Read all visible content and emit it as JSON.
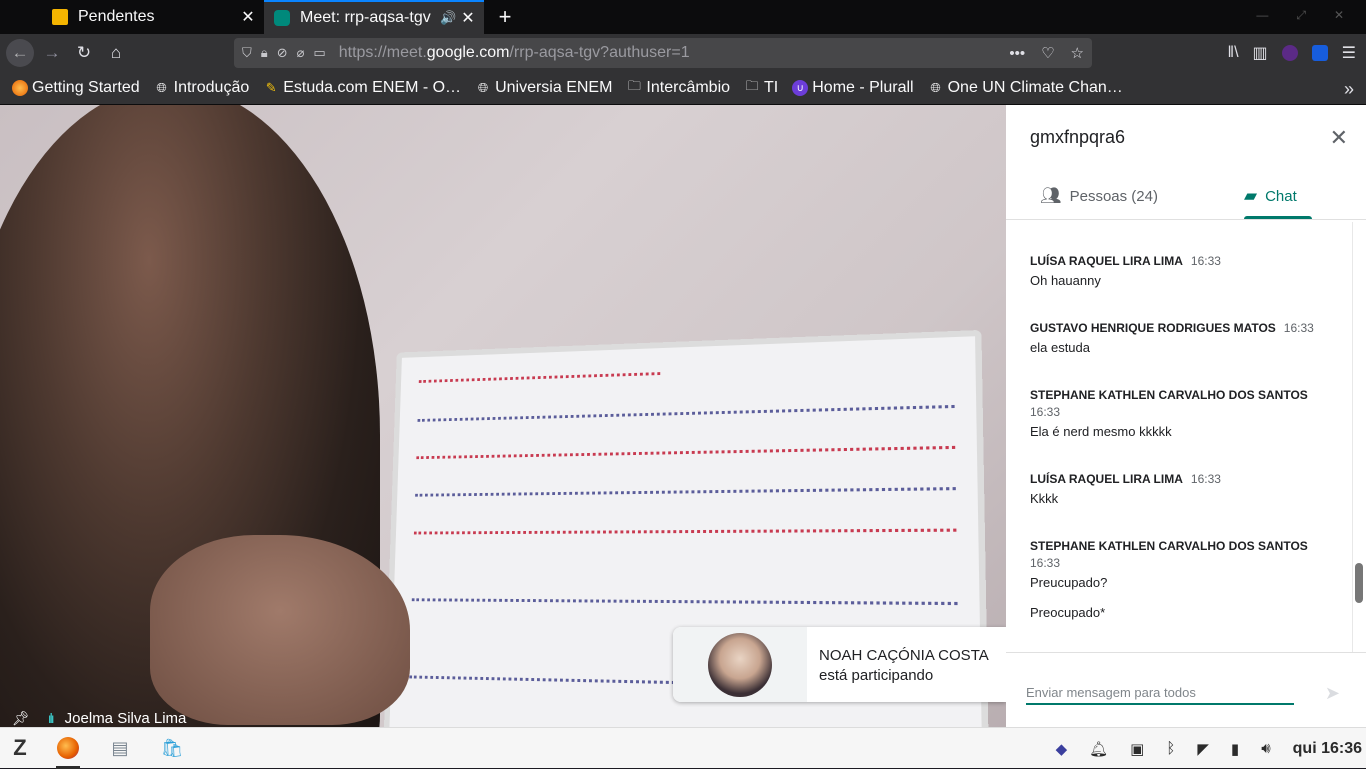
{
  "browser": {
    "tabs": [
      {
        "title": "Pendentes",
        "active": false
      },
      {
        "title": "Meet: rrp-aqsa-tgv",
        "active": true
      }
    ],
    "url": {
      "prefix": "https://meet.",
      "host": "google.com",
      "path": "/rrp-aqsa-tgv?authuser=1"
    },
    "bookmarks": [
      "Getting Started",
      "Introdução",
      "Estuda.com ENEM - O…",
      "Universia ENEM",
      "Intercâmbio",
      "TI",
      "Home - Plurall",
      "One UN Climate Chan…"
    ]
  },
  "meet": {
    "speaker_name": "Joelma Silva Lima",
    "notification": {
      "name": "NOAH CAÇÓNIA COSTA",
      "status": "está participando"
    }
  },
  "panel": {
    "meeting_code": "gmxfnpqra6",
    "people_tab": "Pessoas (24)",
    "chat_tab": "Chat",
    "messages": [
      {
        "sender": "LUÍSA RAQUEL LIRA LIMA",
        "time": "16:33",
        "text": "Oh hauanny"
      },
      {
        "sender": "GUSTAVO HENRIQUE RODRIGUES MATOS",
        "time": "16:33",
        "text": "ela estuda"
      },
      {
        "sender": "STEPHANE KATHLEN CARVALHO DOS SANTOS",
        "time": "16:33",
        "text": "Ela é nerd mesmo kkkkk"
      },
      {
        "sender": "LUÍSA RAQUEL LIRA LIMA",
        "time": "16:33",
        "text": "Kkkk"
      },
      {
        "sender": "STEPHANE KATHLEN CARVALHO DOS SANTOS",
        "time": "16:33",
        "text": "Preucupado?",
        "extra": "Preocupado*"
      }
    ],
    "composer_placeholder": "Enviar mensagem para todos"
  },
  "taskbar": {
    "clock": "qui 16:36"
  },
  "colors": {
    "accent": "#00796b",
    "firefox_tab_highlight": "#0a84ff"
  }
}
